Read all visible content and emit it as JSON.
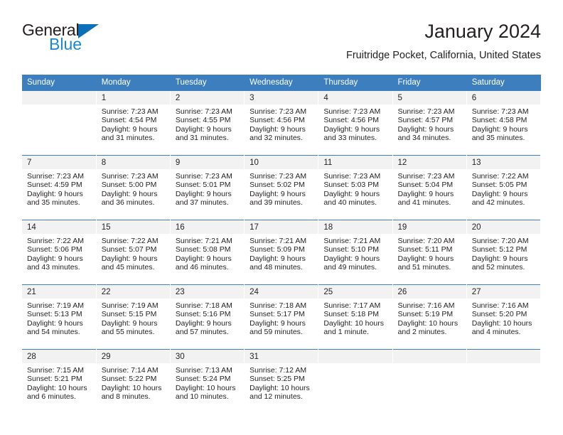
{
  "brand": {
    "name_part1": "General",
    "name_part2": "Blue",
    "triangle_icon": "triangle-icon",
    "color_dark": "#231f20",
    "color_blue": "#1b87d4"
  },
  "header": {
    "month_title": "January 2024",
    "location": "Fruitridge Pocket, California, United States"
  },
  "theme": {
    "header_blue": "#3d7fbe",
    "daynum_band": "#f2f2f2",
    "text": "#231f20"
  },
  "calendar": {
    "weekday_headers": [
      "Sunday",
      "Monday",
      "Tuesday",
      "Wednesday",
      "Thursday",
      "Friday",
      "Saturday"
    ],
    "weeks": [
      [
        {
          "day": "",
          "lines": []
        },
        {
          "day": "1",
          "lines": [
            "Sunrise: 7:23 AM",
            "Sunset: 4:54 PM",
            "Daylight: 9 hours",
            "and 31 minutes."
          ]
        },
        {
          "day": "2",
          "lines": [
            "Sunrise: 7:23 AM",
            "Sunset: 4:55 PM",
            "Daylight: 9 hours",
            "and 31 minutes."
          ]
        },
        {
          "day": "3",
          "lines": [
            "Sunrise: 7:23 AM",
            "Sunset: 4:56 PM",
            "Daylight: 9 hours",
            "and 32 minutes."
          ]
        },
        {
          "day": "4",
          "lines": [
            "Sunrise: 7:23 AM",
            "Sunset: 4:56 PM",
            "Daylight: 9 hours",
            "and 33 minutes."
          ]
        },
        {
          "day": "5",
          "lines": [
            "Sunrise: 7:23 AM",
            "Sunset: 4:57 PM",
            "Daylight: 9 hours",
            "and 34 minutes."
          ]
        },
        {
          "day": "6",
          "lines": [
            "Sunrise: 7:23 AM",
            "Sunset: 4:58 PM",
            "Daylight: 9 hours",
            "and 35 minutes."
          ]
        }
      ],
      [
        {
          "day": "7",
          "lines": [
            "Sunrise: 7:23 AM",
            "Sunset: 4:59 PM",
            "Daylight: 9 hours",
            "and 35 minutes."
          ]
        },
        {
          "day": "8",
          "lines": [
            "Sunrise: 7:23 AM",
            "Sunset: 5:00 PM",
            "Daylight: 9 hours",
            "and 36 minutes."
          ]
        },
        {
          "day": "9",
          "lines": [
            "Sunrise: 7:23 AM",
            "Sunset: 5:01 PM",
            "Daylight: 9 hours",
            "and 37 minutes."
          ]
        },
        {
          "day": "10",
          "lines": [
            "Sunrise: 7:23 AM",
            "Sunset: 5:02 PM",
            "Daylight: 9 hours",
            "and 39 minutes."
          ]
        },
        {
          "day": "11",
          "lines": [
            "Sunrise: 7:23 AM",
            "Sunset: 5:03 PM",
            "Daylight: 9 hours",
            "and 40 minutes."
          ]
        },
        {
          "day": "12",
          "lines": [
            "Sunrise: 7:23 AM",
            "Sunset: 5:04 PM",
            "Daylight: 9 hours",
            "and 41 minutes."
          ]
        },
        {
          "day": "13",
          "lines": [
            "Sunrise: 7:22 AM",
            "Sunset: 5:05 PM",
            "Daylight: 9 hours",
            "and 42 minutes."
          ]
        }
      ],
      [
        {
          "day": "14",
          "lines": [
            "Sunrise: 7:22 AM",
            "Sunset: 5:06 PM",
            "Daylight: 9 hours",
            "and 43 minutes."
          ]
        },
        {
          "day": "15",
          "lines": [
            "Sunrise: 7:22 AM",
            "Sunset: 5:07 PM",
            "Daylight: 9 hours",
            "and 45 minutes."
          ]
        },
        {
          "day": "16",
          "lines": [
            "Sunrise: 7:21 AM",
            "Sunset: 5:08 PM",
            "Daylight: 9 hours",
            "and 46 minutes."
          ]
        },
        {
          "day": "17",
          "lines": [
            "Sunrise: 7:21 AM",
            "Sunset: 5:09 PM",
            "Daylight: 9 hours",
            "and 48 minutes."
          ]
        },
        {
          "day": "18",
          "lines": [
            "Sunrise: 7:21 AM",
            "Sunset: 5:10 PM",
            "Daylight: 9 hours",
            "and 49 minutes."
          ]
        },
        {
          "day": "19",
          "lines": [
            "Sunrise: 7:20 AM",
            "Sunset: 5:11 PM",
            "Daylight: 9 hours",
            "and 51 minutes."
          ]
        },
        {
          "day": "20",
          "lines": [
            "Sunrise: 7:20 AM",
            "Sunset: 5:12 PM",
            "Daylight: 9 hours",
            "and 52 minutes."
          ]
        }
      ],
      [
        {
          "day": "21",
          "lines": [
            "Sunrise: 7:19 AM",
            "Sunset: 5:13 PM",
            "Daylight: 9 hours",
            "and 54 minutes."
          ]
        },
        {
          "day": "22",
          "lines": [
            "Sunrise: 7:19 AM",
            "Sunset: 5:15 PM",
            "Daylight: 9 hours",
            "and 55 minutes."
          ]
        },
        {
          "day": "23",
          "lines": [
            "Sunrise: 7:18 AM",
            "Sunset: 5:16 PM",
            "Daylight: 9 hours",
            "and 57 minutes."
          ]
        },
        {
          "day": "24",
          "lines": [
            "Sunrise: 7:18 AM",
            "Sunset: 5:17 PM",
            "Daylight: 9 hours",
            "and 59 minutes."
          ]
        },
        {
          "day": "25",
          "lines": [
            "Sunrise: 7:17 AM",
            "Sunset: 5:18 PM",
            "Daylight: 10 hours",
            "and 1 minute."
          ]
        },
        {
          "day": "26",
          "lines": [
            "Sunrise: 7:16 AM",
            "Sunset: 5:19 PM",
            "Daylight: 10 hours",
            "and 2 minutes."
          ]
        },
        {
          "day": "27",
          "lines": [
            "Sunrise: 7:16 AM",
            "Sunset: 5:20 PM",
            "Daylight: 10 hours",
            "and 4 minutes."
          ]
        }
      ],
      [
        {
          "day": "28",
          "lines": [
            "Sunrise: 7:15 AM",
            "Sunset: 5:21 PM",
            "Daylight: 10 hours",
            "and 6 minutes."
          ]
        },
        {
          "day": "29",
          "lines": [
            "Sunrise: 7:14 AM",
            "Sunset: 5:22 PM",
            "Daylight: 10 hours",
            "and 8 minutes."
          ]
        },
        {
          "day": "30",
          "lines": [
            "Sunrise: 7:13 AM",
            "Sunset: 5:24 PM",
            "Daylight: 10 hours",
            "and 10 minutes."
          ]
        },
        {
          "day": "31",
          "lines": [
            "Sunrise: 7:12 AM",
            "Sunset: 5:25 PM",
            "Daylight: 10 hours",
            "and 12 minutes."
          ]
        },
        {
          "day": "",
          "lines": []
        },
        {
          "day": "",
          "lines": []
        },
        {
          "day": "",
          "lines": []
        }
      ]
    ]
  }
}
